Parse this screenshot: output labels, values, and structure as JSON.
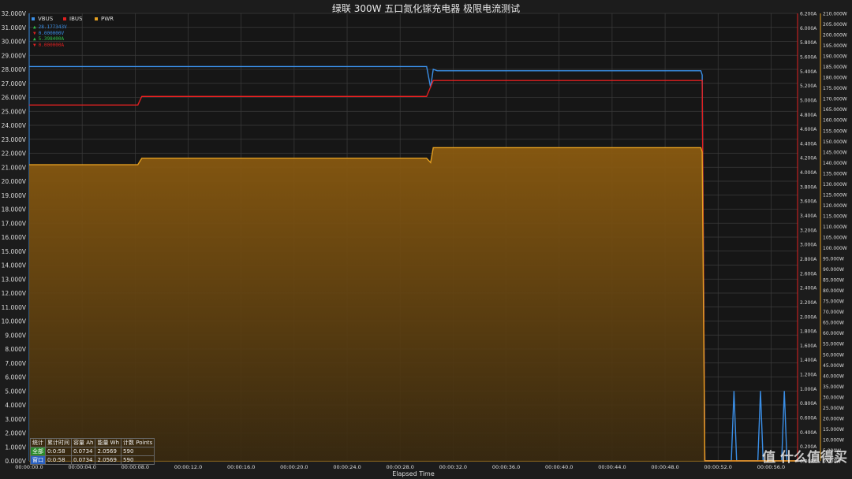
{
  "chart_data": {
    "type": "line",
    "title": "绿联 300W 五口氮化镓充电器 极限电流测试",
    "xlabel": "Elapsed Time",
    "x_ticks": [
      "00:00:00.0",
      "00:00:04.0",
      "00:00:08.0",
      "00:00:12.0",
      "00:00:16.0",
      "00:00:20.0",
      "00:00:24.0",
      "00:00:28.0",
      "00:00:32.0",
      "00:00:36.0",
      "00:00:40.0",
      "00:00:44.0",
      "00:00:48.0",
      "00:00:52.0",
      "00:00:56.0"
    ],
    "xlim": [
      0,
      58
    ],
    "y_left": {
      "unit": "V",
      "ylim": [
        0,
        32
      ],
      "step": 1,
      "tick_labels": [
        "0.000V",
        "1.000V",
        "2.000V",
        "3.000V",
        "4.000V",
        "5.000V",
        "6.000V",
        "7.000V",
        "8.000V",
        "9.000V",
        "10.000V",
        "11.000V",
        "12.000V",
        "13.000V",
        "14.000V",
        "15.000V",
        "16.000V",
        "17.000V",
        "18.000V",
        "19.000V",
        "20.000V",
        "21.000V",
        "22.000V",
        "23.000V",
        "24.000V",
        "25.000V",
        "26.000V",
        "27.000V",
        "28.000V",
        "29.000V",
        "30.000V",
        "31.000V",
        "32.000V"
      ]
    },
    "y_right_current": {
      "unit": "A",
      "ylim": [
        0,
        6.2
      ],
      "step": 0.2,
      "tick_labels": [
        "0.000A",
        "0.200A",
        "0.400A",
        "0.600A",
        "0.800A",
        "1.000A",
        "1.200A",
        "1.400A",
        "1.600A",
        "1.800A",
        "2.000A",
        "2.200A",
        "2.400A",
        "2.600A",
        "2.800A",
        "3.000A",
        "3.200A",
        "3.400A",
        "3.600A",
        "3.800A",
        "4.000A",
        "4.200A",
        "4.400A",
        "4.600A",
        "4.800A",
        "5.000A",
        "5.200A",
        "5.400A",
        "5.600A",
        "5.800A",
        "6.000A",
        "6.200A"
      ]
    },
    "y_right_power": {
      "unit": "W",
      "ylim": [
        0,
        210
      ],
      "step": 5,
      "tick_labels": [
        "0.000W",
        "5.000W",
        "10.000W",
        "15.000W",
        "20.000W",
        "25.000W",
        "30.000W",
        "35.000W",
        "40.000W",
        "45.000W",
        "50.000W",
        "55.000W",
        "60.000W",
        "65.000W",
        "70.000W",
        "75.000W",
        "80.000W",
        "85.000W",
        "90.000W",
        "95.000W",
        "100.000W",
        "105.000W",
        "110.000W",
        "115.000W",
        "120.000W",
        "125.000W",
        "130.000W",
        "135.000W",
        "140.000W",
        "145.000W",
        "150.000W",
        "155.000W",
        "160.000W",
        "165.000W",
        "170.000W",
        "175.000W",
        "180.000W",
        "185.000W",
        "190.000W",
        "195.000W",
        "200.000W",
        "205.000W",
        "210.000W"
      ]
    },
    "series": [
      {
        "name": "VBUS",
        "color": "#3a8ee6",
        "axis": "left",
        "x": [
          0,
          30,
          30.3,
          30.5,
          30.8,
          32,
          34,
          36,
          38,
          40,
          42,
          44,
          46,
          48,
          50,
          50.7,
          50.8,
          51,
          52,
          53,
          53.2,
          53.4,
          54,
          55,
          55.2,
          55.4,
          56,
          56.8,
          57,
          57.2,
          58
        ],
        "y": [
          28.2,
          28.2,
          26.7,
          28.0,
          27.9,
          27.9,
          27.9,
          27.9,
          27.9,
          27.9,
          27.9,
          27.9,
          27.9,
          27.9,
          27.9,
          27.9,
          27.6,
          0,
          0,
          0,
          5.0,
          0,
          0,
          0,
          5.0,
          0,
          0,
          0,
          5.0,
          0,
          0
        ]
      },
      {
        "name": "IBUS",
        "color": "#e02020",
        "axis": "current",
        "x": [
          0,
          8.2,
          8.5,
          30,
          30.5,
          32,
          36,
          40,
          44,
          48,
          50.8,
          51,
          52,
          58
        ],
        "y": [
          4.93,
          4.93,
          5.05,
          5.05,
          5.27,
          5.27,
          5.27,
          5.27,
          5.27,
          5.27,
          5.27,
          0,
          0,
          0
        ]
      },
      {
        "name": "PWR",
        "color": "#e5a020",
        "axis": "power",
        "x": [
          0,
          8.2,
          8.5,
          30,
          30.3,
          30.5,
          30.8,
          32,
          36,
          40,
          44,
          48,
          50.7,
          50.8,
          51,
          52,
          58
        ],
        "y": [
          139,
          139,
          142,
          142,
          140,
          147,
          147,
          147,
          147,
          147,
          147,
          147,
          147,
          145,
          0,
          0,
          0
        ]
      }
    ],
    "grid": true,
    "legend_position": "top-left"
  },
  "live_readouts": [
    {
      "marker": "▲",
      "value": "28.177343V",
      "color": "#3a8ee6"
    },
    {
      "marker": "▼",
      "value": "0.000000V",
      "color": "#3a8ee6"
    },
    {
      "marker": "▲",
      "value": "5.398400A",
      "color": "#2fc24a"
    },
    {
      "marker": "▼",
      "value": "0.000000A",
      "color": "#e02020"
    }
  ],
  "stats_table": {
    "headers": [
      "统计",
      "累计时间",
      "容量 Ah",
      "能量 Wh",
      "计数 Points"
    ],
    "rows": [
      {
        "label": "全部",
        "label_color": "#2a8a2a",
        "cells": [
          "0:0:58",
          "0.0734",
          "2.0569",
          "590"
        ]
      },
      {
        "label": "窗口",
        "label_color": "#2a60c0",
        "cells": [
          "0:0:58",
          "0.0734",
          "2.0569",
          "590"
        ]
      }
    ]
  },
  "watermark": "值 什么值得买"
}
